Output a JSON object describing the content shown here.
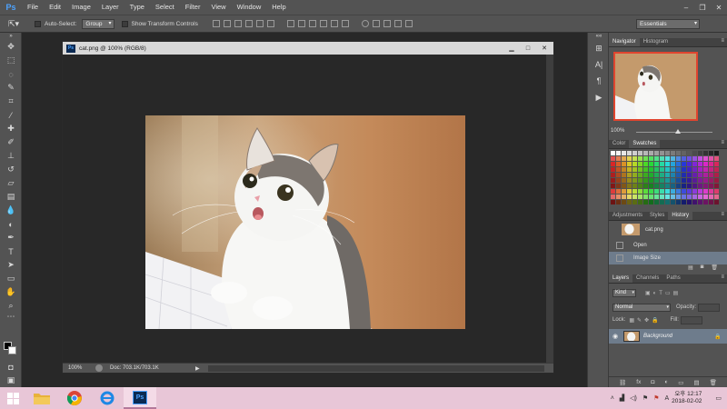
{
  "app": {
    "logo": "Ps"
  },
  "menu": [
    "File",
    "Edit",
    "Image",
    "Layer",
    "Type",
    "Select",
    "Filter",
    "View",
    "Window",
    "Help"
  ],
  "options": {
    "auto_select_label": "Auto-Select:",
    "auto_select_value": "Group",
    "transform_label": "Show Transform Controls",
    "workspace": "Essentials"
  },
  "document": {
    "title": "cat.png @ 100% (RGB/8)",
    "zoom": "100%",
    "doc_size": "Doc: 703.1K/703.1K"
  },
  "navigator": {
    "tabs": [
      "Navigator",
      "Histogram"
    ],
    "zoom": "100%"
  },
  "swatches": {
    "tabs": [
      "Color",
      "Swatches"
    ]
  },
  "history": {
    "tabs": [
      "Adjustments",
      "Styles",
      "History"
    ],
    "snapshot": "cat.png",
    "items": [
      "Open",
      "Image Size"
    ]
  },
  "layers": {
    "tabs": [
      "Layers",
      "Channels",
      "Paths"
    ],
    "kind": "Kind",
    "blend": "Normal",
    "opacity_label": "Opacity:",
    "lock_label": "Lock:",
    "fill_label": "Fill:",
    "layer_name": "Background"
  },
  "taskbar": {
    "time": "오후 12:17",
    "date": "2018-02-02"
  },
  "colors": {
    "accent": "#4da3ff",
    "selected_row": "#6e7c8c",
    "nav_frame": "#e0452f"
  }
}
